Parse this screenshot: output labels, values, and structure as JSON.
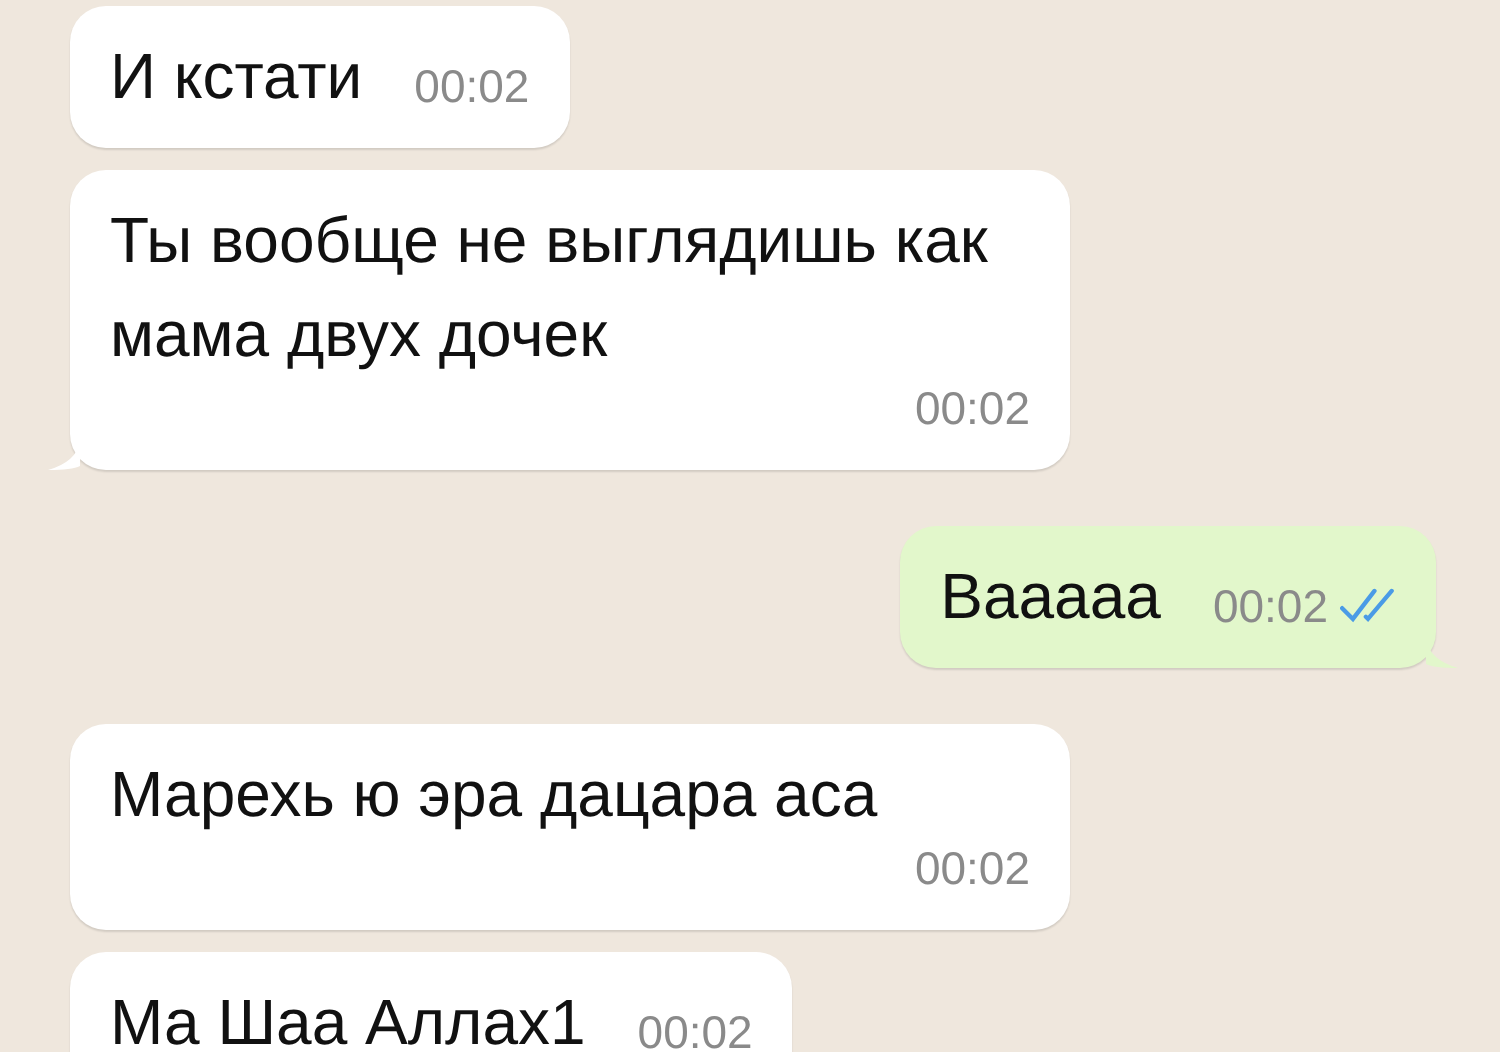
{
  "messages": [
    {
      "kind": "incoming",
      "text": "И кстати",
      "time": "00:02"
    },
    {
      "kind": "incoming",
      "text": "Ты вообще не выглядишь как мама двух дочек",
      "time": "00:02"
    },
    {
      "kind": "outgoing",
      "text": "Вааааа",
      "time": "00:02",
      "read": true
    },
    {
      "kind": "incoming",
      "text": "Марехь ю эра дацара аса",
      "time": "00:02"
    },
    {
      "kind": "incoming",
      "text": "Ма Шаа Аллах1",
      "time": "00:02"
    }
  ]
}
